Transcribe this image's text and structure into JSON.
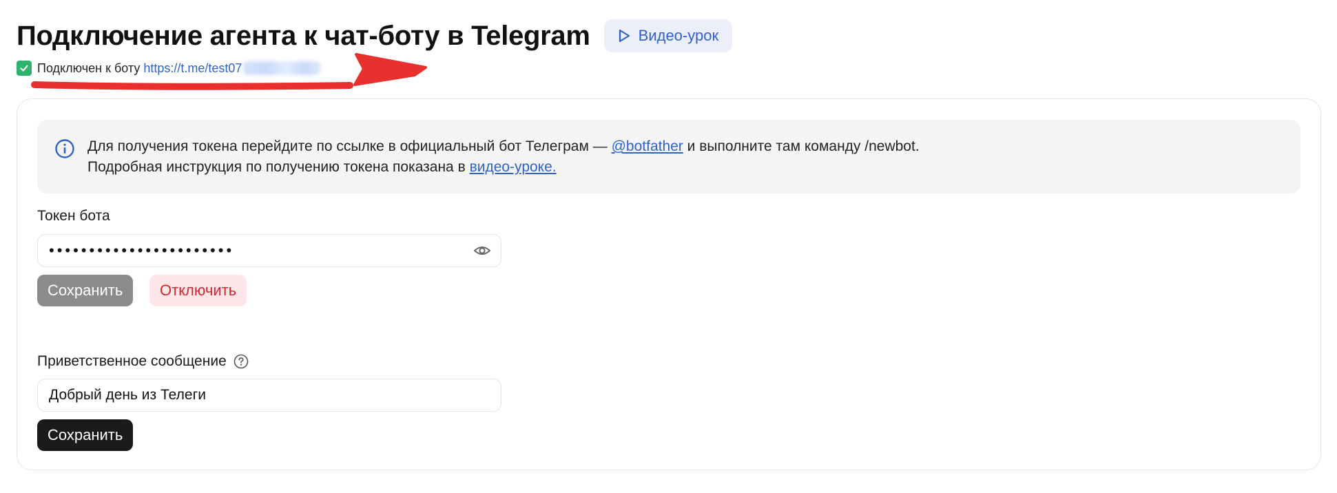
{
  "header": {
    "title": "Подключение агента к чат-боту в Telegram",
    "video_button_label": "Видео-урок"
  },
  "status": {
    "connected_text": "Подключен к боту",
    "bot_link": "https://t.me/test07"
  },
  "info": {
    "line1_prefix": "Для получения токена перейдите по ссылке в официальный бот Телеграм — ",
    "botfather_link": "@botfather",
    "line1_suffix": " и выполните там команду /newbot.",
    "line2_prefix": "Подробная инструкция по получению токена показана в ",
    "video_link": "видео-уроке."
  },
  "token": {
    "label": "Токен бота",
    "value_masked": "•••••••••••••••••••••••",
    "save_label": "Сохранить",
    "disconnect_label": "Отключить"
  },
  "greeting": {
    "label": "Приветственное сообщение",
    "value": "Добрый день из Телеги",
    "save_label": "Сохранить"
  },
  "colors": {
    "accent_blue": "#2f62c9",
    "success_green": "#2fb26a",
    "annotation_red": "#e8312f",
    "danger_red": "#d6242f"
  },
  "icons": {
    "video": "play-icon",
    "status": "checkbox-checked-icon",
    "info": "info-icon",
    "visibility": "eye-icon",
    "help": "question-circle-icon",
    "annotation": "red-arrow-annotation"
  }
}
